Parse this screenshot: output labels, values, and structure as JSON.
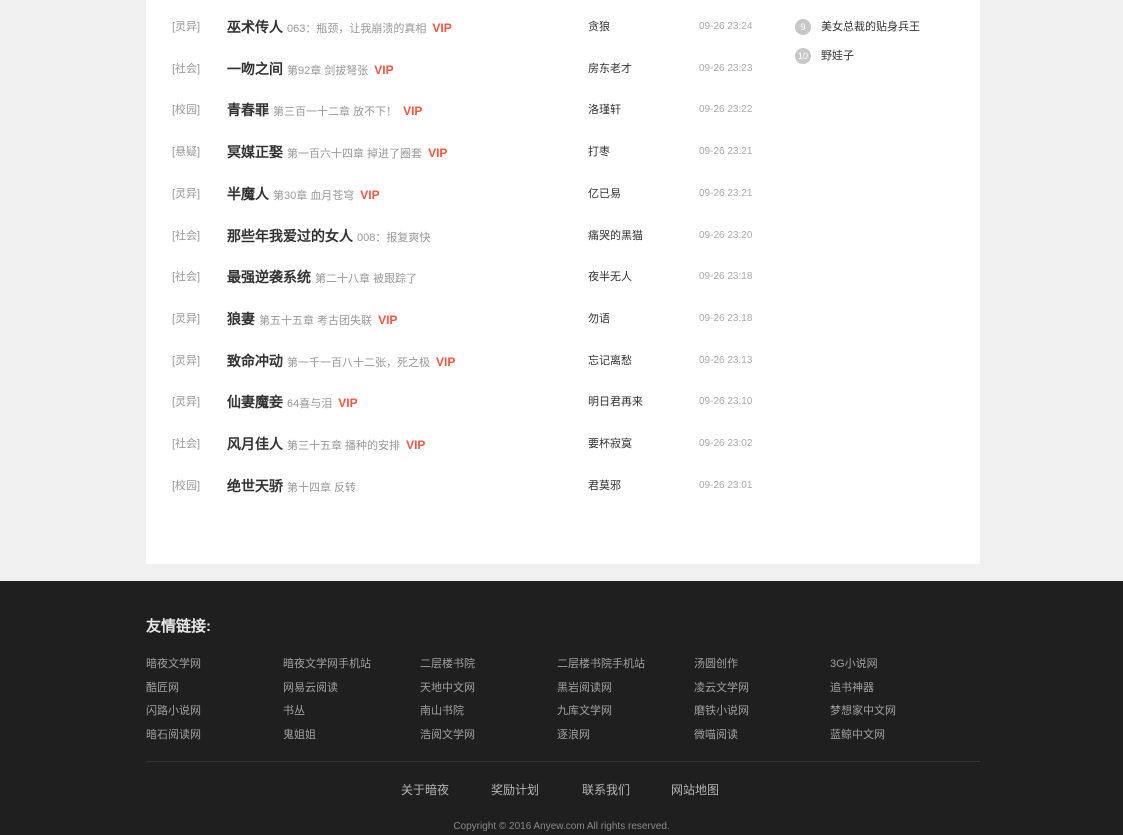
{
  "updates": [
    {
      "category": "[灵异]",
      "title": "巫术传人",
      "chapter": "063：瓶颈，让我崩溃的真相",
      "vip": "VIP",
      "author": "贪狼",
      "time": "09-26 23:24"
    },
    {
      "category": "[社会]",
      "title": "一吻之间",
      "chapter": "第92章 剑拔弩张",
      "vip": "VIP",
      "author": "房东老才",
      "time": "09-26 23:23"
    },
    {
      "category": "[校园]",
      "title": "青春罪",
      "chapter": "第三百一十二章 放不下！",
      "vip": "VIP",
      "author": "洛瑾轩",
      "time": "09-26 23:22"
    },
    {
      "category": "[悬疑]",
      "title": "冥媒正娶",
      "chapter": "第一百六十四章 掉进了圈套",
      "vip": "VIP",
      "author": "打枣",
      "time": "09-26 23:21"
    },
    {
      "category": "[灵异]",
      "title": "半魔人",
      "chapter": "第30章 血月苍穹",
      "vip": "VIP",
      "author": "亿已易",
      "time": "09-26 23:21"
    },
    {
      "category": "[社会]",
      "title": "那些年我爱过的女人",
      "chapter": "008：报复爽快",
      "vip": "",
      "author": "痛哭的黑猫",
      "time": "09-26 23:20"
    },
    {
      "category": "[社会]",
      "title": "最强逆袭系统",
      "chapter": "第二十八章 被跟踪了",
      "vip": "",
      "author": "夜半无人",
      "time": "09-26 23:18"
    },
    {
      "category": "[灵异]",
      "title": "狼妻",
      "chapter": "第五十五章 考古团失联",
      "vip": "VIP",
      "author": "勿语",
      "time": "09-26 23:18"
    },
    {
      "category": "[灵异]",
      "title": "致命冲动",
      "chapter": "第一千一百八十二张，死之极",
      "vip": "VIP",
      "author": "忘记离愁",
      "time": "09-26 23:13"
    },
    {
      "category": "[灵异]",
      "title": "仙妻魔妾",
      "chapter": "64喜与泪",
      "vip": "VIP",
      "author": "明日君再来",
      "time": "09-26 23:10"
    },
    {
      "category": "[社会]",
      "title": "风月佳人",
      "chapter": "第三十五章 播种的安排",
      "vip": "VIP",
      "author": "要杯寂寞",
      "time": "09-26 23:02"
    },
    {
      "category": "[校园]",
      "title": "绝世天骄",
      "chapter": "第十四章 反转",
      "vip": "",
      "author": "君莫邪",
      "time": "09-26 23:01"
    }
  ],
  "ranking": [
    {
      "num": "9",
      "title": "美女总裁的贴身兵王"
    },
    {
      "num": "10",
      "title": "野娃子"
    }
  ],
  "footer": {
    "friend_title": "友情链接:",
    "friend_links": [
      [
        "暗夜文学网",
        "暗夜文学网手机站",
        "二层楼书院",
        "二层楼书院手机站",
        "汤圆创作",
        "3G小说网"
      ],
      [
        "酷匠网",
        "网易云阅读",
        "天地中文网",
        "黑岩阅读网",
        "凌云文学网",
        "追书神器"
      ],
      [
        "闪路小说网",
        "书丛",
        "南山书院",
        "九库文学网",
        "磨铁小说网",
        "梦想家中文网"
      ],
      [
        "暗石阅读网",
        "鬼姐姐",
        "浩阅文学网",
        "逐浪网",
        "微喵阅读",
        "蓝鲸中文网"
      ]
    ],
    "nav": [
      "关于暗夜",
      "奖励计划",
      "联系我们",
      "网站地图"
    ],
    "copyright": "Copyright © 2016 Anyew.com All rights reserved."
  }
}
